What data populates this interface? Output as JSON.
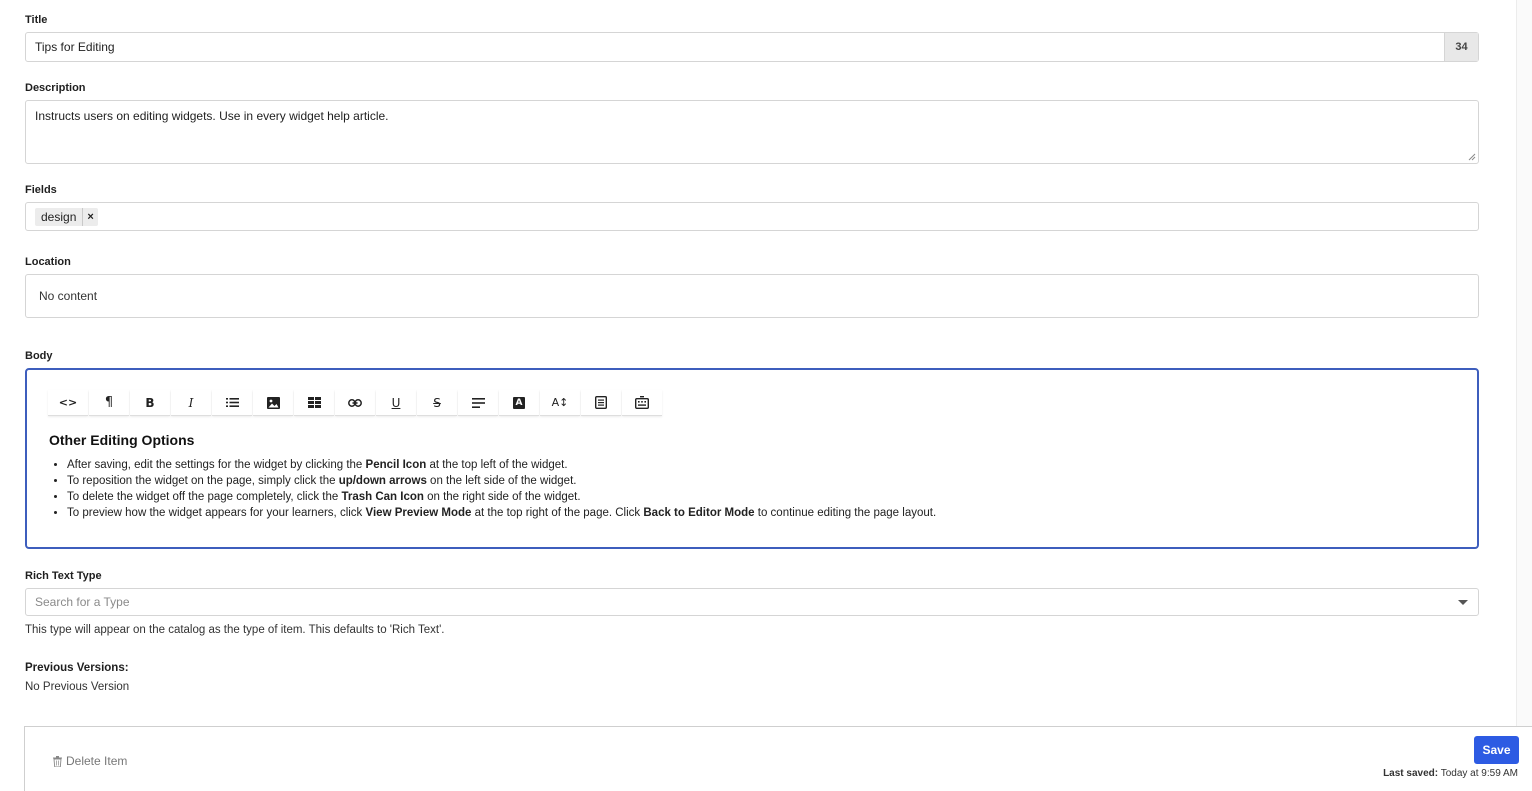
{
  "title_field": {
    "label": "Title",
    "value": "Tips for Editing",
    "counter": "34"
  },
  "description_field": {
    "label": "Description",
    "value": "Instructs users on editing widgets. Use in every widget help article."
  },
  "fields_field": {
    "label": "Fields",
    "tags": [
      "design"
    ],
    "remove_glyph": "×"
  },
  "location_field": {
    "label": "Location",
    "value": "No content"
  },
  "body_field": {
    "label": "Body",
    "toolbar": [
      {
        "name": "code-view-icon",
        "glyph": "<>"
      },
      {
        "name": "paragraph-icon",
        "glyph": "¶"
      },
      {
        "name": "bold-icon",
        "glyph": "B"
      },
      {
        "name": "italic-icon",
        "glyph": "I"
      },
      {
        "name": "bulleted-list-icon"
      },
      {
        "name": "image-icon"
      },
      {
        "name": "table-icon"
      },
      {
        "name": "link-icon"
      },
      {
        "name": "underline-icon",
        "glyph": "U"
      },
      {
        "name": "strikethrough-icon",
        "glyph": "S"
      },
      {
        "name": "align-icon"
      },
      {
        "name": "text-color-icon",
        "glyph": "A"
      },
      {
        "name": "font-size-icon",
        "glyph": "A↕"
      },
      {
        "name": "format-block-icon"
      },
      {
        "name": "embed-icon"
      }
    ],
    "heading": "Other Editing Options",
    "items": [
      [
        {
          "t": "After saving, edit the settings for the widget by clicking the "
        },
        {
          "t": "Pencil Icon",
          "b": true
        },
        {
          "t": " at the top left of the widget."
        }
      ],
      [
        {
          "t": "To reposition the widget on the page, simply click the "
        },
        {
          "t": "up/down arrows",
          "b": true
        },
        {
          "t": " on the left side of the widget."
        }
      ],
      [
        {
          "t": "To delete the widget off the page completely, click the "
        },
        {
          "t": "Trash Can Icon",
          "b": true
        },
        {
          "t": " on the right side of the widget."
        }
      ],
      [
        {
          "t": "To preview how the widget appears for your learners, click "
        },
        {
          "t": "View Preview Mode",
          "b": true
        },
        {
          "t": " at the top right of the page. Click "
        },
        {
          "t": "Back to Editor Mode",
          "b": true
        },
        {
          "t": " to continue editing the page layout."
        }
      ]
    ]
  },
  "rich_text_type": {
    "label": "Rich Text Type",
    "placeholder": "Search for a Type",
    "helper": "This type will appear on the catalog as the type of item. This defaults to 'Rich Text'."
  },
  "previous_versions": {
    "label": "Previous Versions:",
    "value": "No Previous Version"
  },
  "footer": {
    "delete_label": "Delete Item",
    "save_label": "Save",
    "last_saved_label": "Last saved:",
    "last_saved_value": "Today at 9:59 AM"
  },
  "colors": {
    "accent": "#2d5be3",
    "editor_focus": "#3e5ebd"
  }
}
